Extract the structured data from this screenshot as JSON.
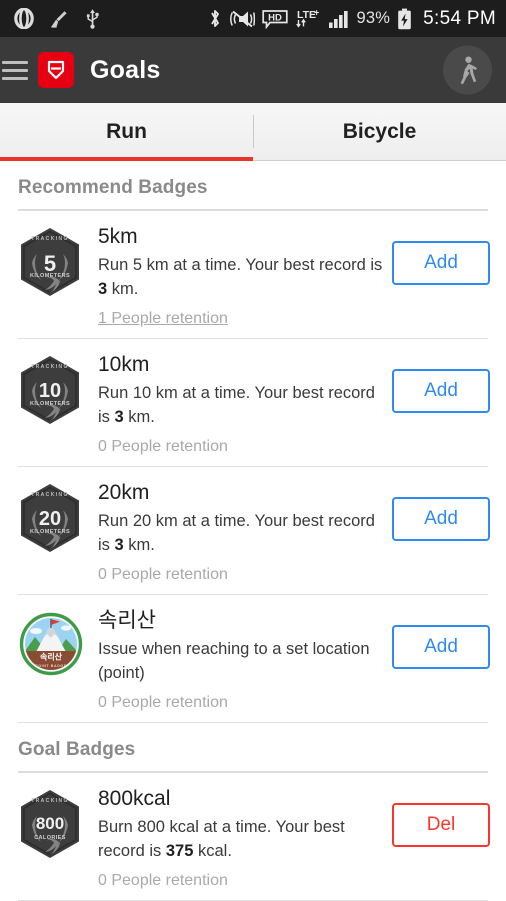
{
  "statusbar": {
    "left_icons": [
      "opera-icon",
      "broom-icon",
      "usb-icon"
    ],
    "right_icons": [
      "bluetooth-icon",
      "mute-icon",
      "hd-call-icon",
      "lte-plus-icon",
      "signal-bars-icon",
      "battery-charging-icon"
    ],
    "battery_percent": "93%",
    "clock": "5:54 PM"
  },
  "appbar": {
    "menu_icon": "hamburger-icon",
    "logo_icon": "shield-logo-icon",
    "title": "Goals",
    "avatar_icon": "walking-person-icon"
  },
  "tabs": [
    {
      "label": "Run",
      "active": true
    },
    {
      "label": "Bicycle",
      "active": false
    }
  ],
  "sections": [
    {
      "title": "Recommend Badges",
      "rows": [
        {
          "badge": {
            "type": "hex",
            "top": "TRACKING",
            "number": "5",
            "unit": "KILOMETERS",
            "numsize": "22px"
          },
          "title": "5km",
          "desc_parts": [
            {
              "text": "Run 5 km at a time. Your best record is ",
              "bold": false
            },
            {
              "text": "3",
              "bold": true
            },
            {
              "text": " km.",
              "bold": false
            }
          ],
          "retention": "1 People retention",
          "retention_underlined": true,
          "button": {
            "label": "Add",
            "kind": "add"
          }
        },
        {
          "badge": {
            "type": "hex",
            "top": "TRACKING",
            "number": "10",
            "unit": "KILOMETERS",
            "numsize": "20px"
          },
          "title": "10km",
          "desc_parts": [
            {
              "text": "Run 10 km at a time. Your best record is ",
              "bold": false
            },
            {
              "text": "3",
              "bold": true
            },
            {
              "text": " km.",
              "bold": false
            }
          ],
          "retention": "0 People retention",
          "retention_underlined": false,
          "button": {
            "label": "Add",
            "kind": "add"
          }
        },
        {
          "badge": {
            "type": "hex",
            "top": "TRACKING",
            "number": "20",
            "unit": "KILOMETERS",
            "numsize": "20px"
          },
          "title": "20km",
          "desc_parts": [
            {
              "text": "Run 20 km at a time. Your best record is ",
              "bold": false
            },
            {
              "text": "3",
              "bold": true
            },
            {
              "text": " km.",
              "bold": false
            }
          ],
          "retention": "0 People retention",
          "retention_underlined": false,
          "button": {
            "label": "Add",
            "kind": "add"
          }
        },
        {
          "badge": {
            "type": "mountain",
            "banner": "속리산",
            "sub": "POINT BADGE"
          },
          "title": "속리산",
          "desc_parts": [
            {
              "text": "Issue when reaching to a set location (point)",
              "bold": false
            }
          ],
          "retention": "0 People retention",
          "retention_underlined": false,
          "button": {
            "label": "Add",
            "kind": "add"
          }
        }
      ]
    },
    {
      "title": "Goal Badges",
      "rows": [
        {
          "badge": {
            "type": "hex",
            "top": "TRACKING",
            "number": "800",
            "unit": "CALORIES",
            "numsize": "17px"
          },
          "title": "800kcal",
          "desc_parts": [
            {
              "text": "Burn 800 kcal at a time. Your best record is ",
              "bold": false
            },
            {
              "text": "375",
              "bold": true
            },
            {
              "text": " kcal.",
              "bold": false
            }
          ],
          "retention": "0 People retention",
          "retention_underlined": false,
          "button": {
            "label": "Del",
            "kind": "del"
          }
        }
      ]
    }
  ],
  "colors": {
    "accent_red": "#e8342a",
    "logo_red": "#e60012",
    "add_blue": "#2e8bf0",
    "del_red": "#f7372b",
    "statusbar_bg": "#1d1d1d",
    "appbar_bg": "#3a3a3a"
  }
}
